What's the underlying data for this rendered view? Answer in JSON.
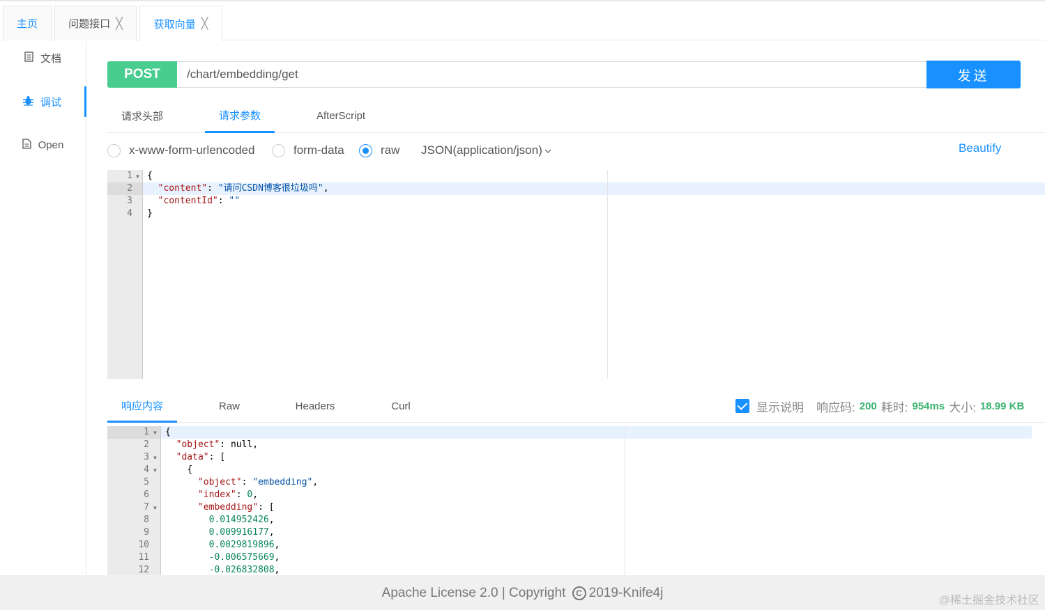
{
  "tabs": [
    {
      "label": "主页"
    },
    {
      "label": "问题接口",
      "close": "╳"
    },
    {
      "label": "获取向量",
      "close": "╳"
    }
  ],
  "sidebar": {
    "items": [
      {
        "label": "文档"
      },
      {
        "label": "调试"
      },
      {
        "label": "Open"
      }
    ]
  },
  "request": {
    "method": "POST",
    "url": "/chart/embedding/get",
    "send_label": "发送"
  },
  "param_tabs": [
    "请求头部",
    "请求参数",
    "AfterScript"
  ],
  "body_types": {
    "urlencoded": "x-www-form-urlencoded",
    "formdata": "form-data",
    "raw": "raw",
    "content_type": "JSON(application/json)",
    "beautify": "Beautify"
  },
  "request_body": {
    "line_numbers": [
      "1",
      "2",
      "3",
      "4"
    ],
    "lines": [
      {
        "t": "{"
      },
      {
        "k": "\"content\"",
        "sep": ": ",
        "v": "\"请问CSDN博客很垃圾吗\"",
        "end": ","
      },
      {
        "k": "\"contentId\"",
        "sep": ": ",
        "v": "\"\"",
        "end": ""
      },
      {
        "t": "}"
      }
    ]
  },
  "response_tabs": [
    "响应内容",
    "Raw",
    "Headers",
    "Curl"
  ],
  "response_info": {
    "show_desc": "显示说明",
    "code_label": "响应码:",
    "code": "200",
    "time_label": "耗时:",
    "time": "954ms",
    "size_label": "大小:",
    "size": "18.99 KB"
  },
  "response_body": {
    "line_numbers": [
      "1",
      "2",
      "3",
      "4",
      "5",
      "6",
      "7",
      "8",
      "9",
      "10",
      "11",
      "12"
    ],
    "lines": [
      {
        "t": "{"
      },
      {
        "ind": "  ",
        "k": "\"object\"",
        "sep": ": ",
        "lit": "null",
        "end": ","
      },
      {
        "ind": "  ",
        "k": "\"data\"",
        "sep": ": ",
        "t2": "["
      },
      {
        "ind": "    ",
        "t2": "{"
      },
      {
        "ind": "      ",
        "k": "\"object\"",
        "sep": ": ",
        "v": "\"embedding\"",
        "end": ","
      },
      {
        "ind": "      ",
        "k": "\"index\"",
        "sep": ": ",
        "num": "0",
        "end": ","
      },
      {
        "ind": "      ",
        "k": "\"embedding\"",
        "sep": ": ",
        "t2": "["
      },
      {
        "ind": "        ",
        "num": "0.014952426",
        "end": ","
      },
      {
        "ind": "        ",
        "num": "0.009916177",
        "end": ","
      },
      {
        "ind": "        ",
        "num": "0.0029819896",
        "end": ","
      },
      {
        "ind": "        ",
        "num": "-0.006575669",
        "end": ","
      },
      {
        "ind": "        ",
        "num": "-0.026832808",
        "end": ","
      }
    ]
  },
  "footer": {
    "license": "Apache License 2.0 | Copyright",
    "copy_symbol": "C",
    "years": "2019-Knife4j",
    "watermark": "@稀土掘金技术社区"
  }
}
